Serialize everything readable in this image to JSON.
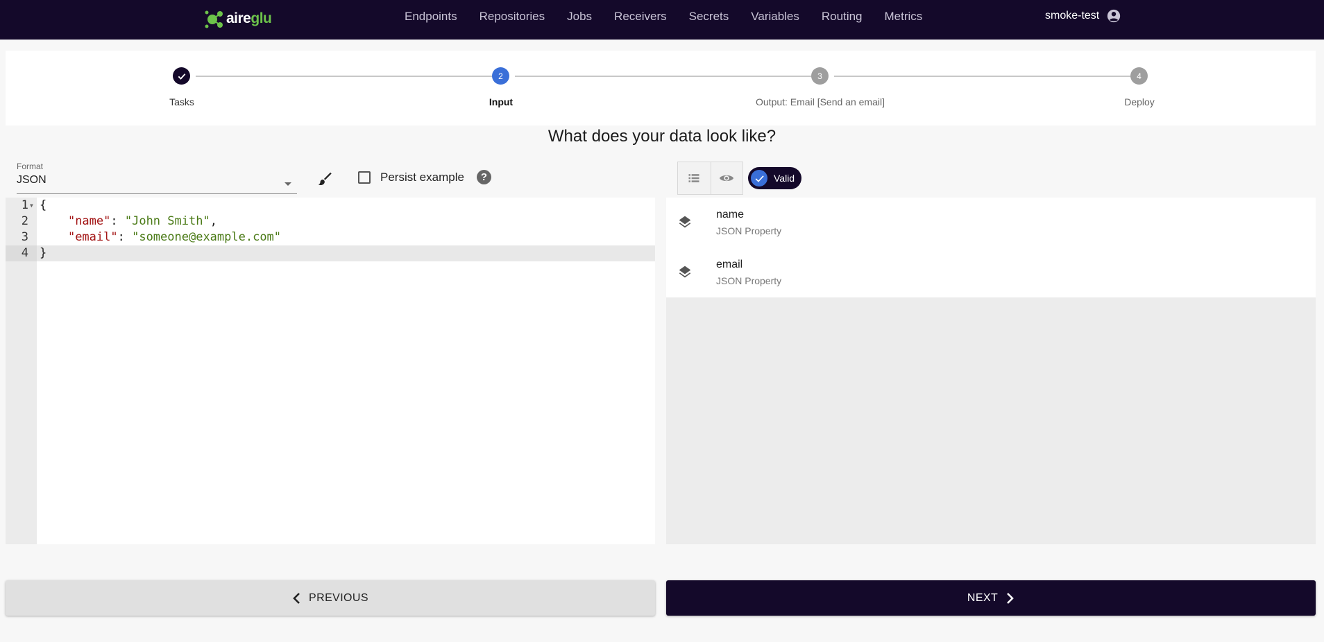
{
  "brand": {
    "part1": "aire",
    "part2": "glu"
  },
  "nav": {
    "links": [
      "Endpoints",
      "Repositories",
      "Jobs",
      "Receivers",
      "Secrets",
      "Variables",
      "Routing",
      "Metrics"
    ],
    "username": "smoke-test"
  },
  "stepper": {
    "steps": [
      {
        "label": "Tasks",
        "number": "1",
        "state": "completed"
      },
      {
        "label": "Input",
        "number": "2",
        "state": "active"
      },
      {
        "label": "Output: Email [Send an email]",
        "number": "3",
        "state": "pending"
      },
      {
        "label": "Deploy",
        "number": "4",
        "state": "pending"
      }
    ]
  },
  "heading": "What does your data look like?",
  "format": {
    "label": "Format",
    "value": "JSON"
  },
  "persist": {
    "label": "Persist example",
    "checked": false,
    "help_glyph": "?"
  },
  "editor": {
    "line_numbers": [
      "1",
      "2",
      "3",
      "4"
    ],
    "lines": [
      {
        "text": "{"
      },
      {
        "key": "\"name\"",
        "sep": ": ",
        "value": "\"John Smith\"",
        "trail": ",",
        "indent": "    "
      },
      {
        "key": "\"email\"",
        "sep": ": ",
        "value": "\"someone@example.com\"",
        "trail": "",
        "indent": "    "
      },
      {
        "text": "}"
      }
    ],
    "active_line": 4
  },
  "validation": {
    "label": "Valid"
  },
  "properties": [
    {
      "name": "name",
      "type": "JSON Property",
      "icon": "layers-icon"
    },
    {
      "name": "email",
      "type": "JSON Property",
      "icon": "layers-icon"
    }
  ],
  "buttons": {
    "previous": "PREVIOUS",
    "next": "NEXT"
  },
  "colors": {
    "nav_bg": "#14092a",
    "brand_green": "#6cc24a",
    "step_active": "#3a6fd8",
    "step_pending": "#9e9e9e"
  }
}
